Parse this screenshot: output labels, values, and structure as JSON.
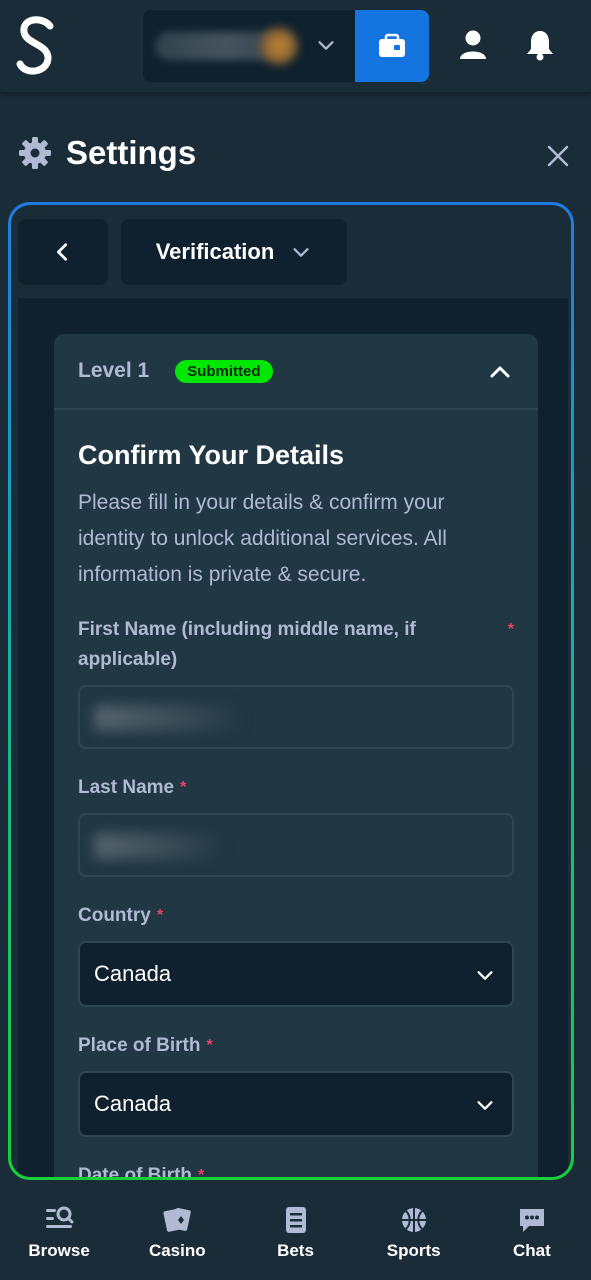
{
  "header": {
    "logo_glyph": "S",
    "wallet_balance": "",
    "accent_color": "#1475e1"
  },
  "settings": {
    "title": "Settings"
  },
  "breadcrumb": {
    "label": "Verification"
  },
  "level_card": {
    "level": "Level 1",
    "status": "Submitted",
    "title": "Confirm Your Details",
    "description": "Please fill in your details & confirm your identity to unlock additional services. All information is private & secure."
  },
  "form": {
    "first_name": {
      "label": "First Name (including middle name, if applicable)",
      "required": "*",
      "value": ""
    },
    "last_name": {
      "label": "Last Name",
      "required": "*",
      "value": ""
    },
    "country": {
      "label": "Country",
      "required": "*",
      "value": "Canada"
    },
    "place_of_birth": {
      "label": "Place of Birth",
      "required": "*",
      "value": "Canada"
    },
    "date_of_birth": {
      "label": "Date of Birth",
      "required": "*"
    }
  },
  "bottom_nav": {
    "items": [
      {
        "label": "Browse",
        "icon": "browse-icon"
      },
      {
        "label": "Casino",
        "icon": "casino-cards-icon"
      },
      {
        "label": "Bets",
        "icon": "bets-list-icon"
      },
      {
        "label": "Sports",
        "icon": "basketball-icon"
      },
      {
        "label": "Chat",
        "icon": "chat-bubble-icon"
      }
    ]
  }
}
